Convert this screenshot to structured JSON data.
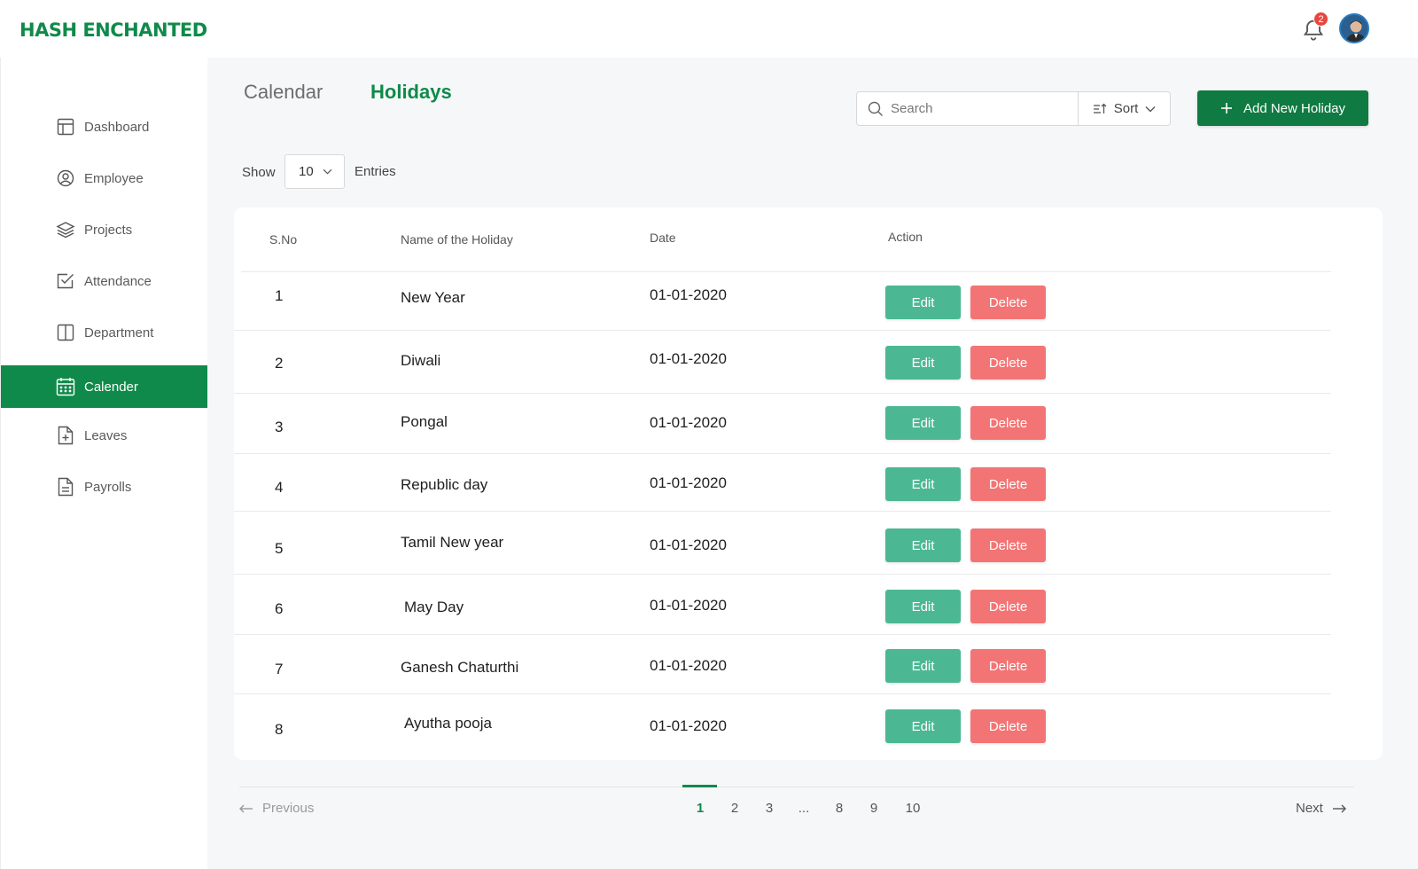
{
  "header": {
    "logo_text": "HASH ENCHANTED",
    "notification_count": "2"
  },
  "sidebar": {
    "items": [
      {
        "label": "Dashboard",
        "icon": "dashboard-icon",
        "active": false
      },
      {
        "label": "Employee",
        "icon": "user-circle-icon",
        "active": false
      },
      {
        "label": "Projects",
        "icon": "layers-icon",
        "active": false
      },
      {
        "label": "Attendance",
        "icon": "checkbox-icon",
        "active": false
      },
      {
        "label": "Department",
        "icon": "columns-icon",
        "active": false
      },
      {
        "label": "Calender",
        "icon": "calendar-icon",
        "active": true
      },
      {
        "label": "Leaves",
        "icon": "file-plus-icon",
        "active": false
      },
      {
        "label": "Payrolls",
        "icon": "file-text-icon",
        "active": false
      }
    ]
  },
  "tabs": [
    {
      "label": "Calendar",
      "active": false
    },
    {
      "label": "Holidays",
      "active": true
    }
  ],
  "toolbar": {
    "search_placeholder": "Search",
    "sort_label": "Sort",
    "add_label": "Add New Holiday"
  },
  "entries": {
    "show_label": "Show",
    "value": "10",
    "suffix_label": "Entries"
  },
  "table": {
    "columns": [
      "S.No",
      "Name of the Holiday",
      "Date",
      "Action"
    ],
    "rows": [
      {
        "sno": "1",
        "name": "New Year",
        "date": "01-01-2020"
      },
      {
        "sno": "2",
        "name": "Diwali",
        "date": "01-01-2020"
      },
      {
        "sno": "3",
        "name": "Pongal",
        "date": "01-01-2020"
      },
      {
        "sno": "4",
        "name": "Republic day",
        "date": "01-01-2020"
      },
      {
        "sno": "5",
        "name": "Tamil New year",
        "date": "01-01-2020"
      },
      {
        "sno": "6",
        "name": "May Day",
        "date": "01-01-2020"
      },
      {
        "sno": "7",
        "name": "Ganesh Chaturthi",
        "date": "01-01-2020"
      },
      {
        "sno": "8",
        "name": "Ayutha pooja",
        "date": "01-01-2020"
      }
    ],
    "edit_label": "Edit",
    "delete_label": "Delete"
  },
  "pagination": {
    "previous_label": "Previous",
    "next_label": "Next",
    "pages": [
      "1",
      "2",
      "3",
      "...",
      "8",
      "9",
      "10"
    ],
    "current": "1"
  },
  "colors": {
    "brand": "#0f8a4a",
    "edit": "#4cb893",
    "delete": "#f37474",
    "badge": "#e8473e"
  }
}
